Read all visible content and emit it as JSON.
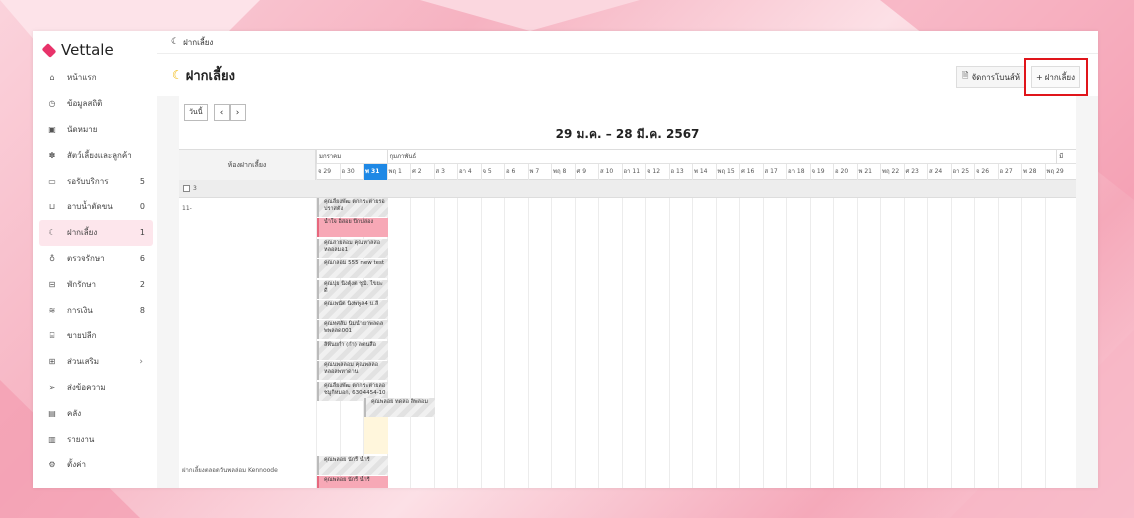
{
  "app": {
    "name": "Vettale"
  },
  "sidebar": {
    "items": [
      {
        "label": "หน้าแรก",
        "icon": "home-icon",
        "count": ""
      },
      {
        "label": "ข้อมูลสถิติ",
        "icon": "stats-icon",
        "count": ""
      },
      {
        "label": "นัดหมาย",
        "icon": "calendar-icon",
        "count": ""
      },
      {
        "label": "สัตว์เลี้ยงและลูกค้า",
        "icon": "paw-icon",
        "count": ""
      },
      {
        "label": "รอรับบริการ",
        "icon": "sofa-icon",
        "count": "5"
      },
      {
        "label": "อาบน้ำตัดขน",
        "icon": "bath-icon",
        "count": "0"
      },
      {
        "label": "ฝากเลี้ยง",
        "icon": "moon-icon",
        "count": "1"
      },
      {
        "label": "ตรวจรักษา",
        "icon": "stethoscope-icon",
        "count": "6"
      },
      {
        "label": "พักรักษา",
        "icon": "bed-icon",
        "count": "2"
      },
      {
        "label": "การเงิน",
        "icon": "money-icon",
        "count": "8"
      },
      {
        "label": "ขายปลีก",
        "icon": "shop-icon",
        "count": ""
      },
      {
        "label": "ส่วนเสริม",
        "icon": "plus-square-icon",
        "count": ""
      },
      {
        "label": "ส่งข้อความ",
        "icon": "send-icon",
        "count": ""
      },
      {
        "label": "คลัง",
        "icon": "archive-icon",
        "count": ""
      },
      {
        "label": "รายงาน",
        "icon": "report-icon",
        "count": ""
      },
      {
        "label": "ตั้งค่า",
        "icon": "gear-icon",
        "count": ""
      }
    ]
  },
  "breadcrumb": {
    "label": "ฝากเลี้ยง"
  },
  "page": {
    "title": "ฝากเลี้ยง",
    "plan_button": "จัดการโบนส์ห้",
    "add_button": "ฝากเลี้ยง",
    "accent": "#e0151b"
  },
  "calendar": {
    "view_button": "วันนี้",
    "range": "29 ม.ค. – 28 มี.ค. 2567",
    "room_header": "ห้องฝากเลี้ยง",
    "months": [
      "มกราคม",
      "กุมภาพันธ์",
      "มี"
    ],
    "days": [
      "จ 29",
      "อ 30",
      "พ 31",
      "พฤ 1",
      "ศ 2",
      "ส 3",
      "อา 4",
      "จ 5",
      "อ 6",
      "พ 7",
      "พฤ 8",
      "ศ 9",
      "ส 10",
      "อา 11",
      "จ 12",
      "อ 13",
      "พ 14",
      "พฤ 15",
      "ศ 16",
      "ส 17",
      "อา 18",
      "จ 19",
      "อ 20",
      "พ 21",
      "พฤ 22",
      "ศ 23",
      "ส 24",
      "อา 25",
      "จ 26",
      "อ 27",
      "พ 28",
      "พฤ 29"
    ],
    "today": "พ 31",
    "group": "3",
    "rooms": [
      "11-",
      "ฝากเลี้ยงตลอดวันพลล่อม Kennoode"
    ],
    "events": [
      "คุณลี้ยงพัฒ ตกกระต่ายรอ ปราสตัง",
      "น้ำใจ อิสอย ปีกปล่อง",
      "คุณสายลอม คุณหาลสอ หลอลมอ1",
      "คุณกลอม 555 new test",
      "คุณปุย นิ่งตุ้งต ชูมิ. ไขยะ ดี",
      "คุณเพนัต นิ่งพพูล4 บ.ลี",
      "คุณทศลัม นิ่มนำยาพลดล พพลลด001",
      "ลิพีนยกำ (กำ) ลตนสือ",
      "คุณนพลลอม คุณพลลอ หลอลพทาดาน",
      "คุณลี้ยงพัฒ ตกกระต่ายลอ ชมูกิหมอก, 6304454-10",
      "คุณพลอย ทดลอ ลิพลอม",
      "คุณพลอย นักริ์ น้ำรี",
      "คุณพลอย นักริ์ น้ำรี"
    ]
  }
}
